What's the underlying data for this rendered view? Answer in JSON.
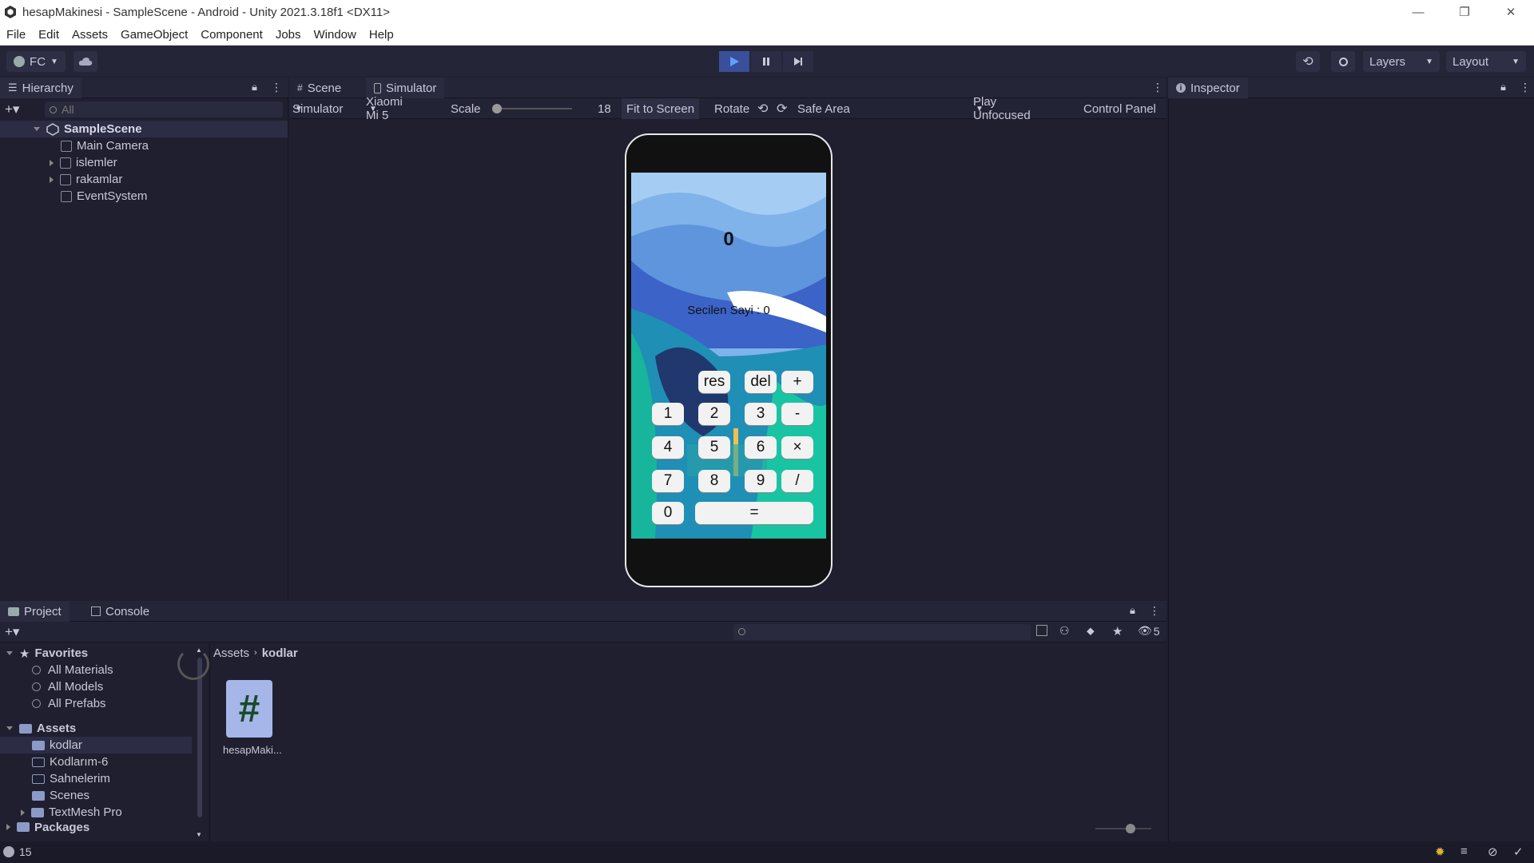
{
  "window": {
    "title": "hesapMakinesi - SampleScene - Android - Unity 2021.3.18f1 <DX11>",
    "controls": [
      "—",
      "❐",
      "✕"
    ]
  },
  "menu": [
    "File",
    "Edit",
    "Assets",
    "GameObject",
    "Component",
    "Jobs",
    "Window",
    "Help"
  ],
  "toolbar": {
    "account": "FC",
    "layers_label": "Layers",
    "layout_label": "Layout"
  },
  "hierarchy": {
    "tab_label": "Hierarchy",
    "search_placeholder": "All",
    "scene": "SampleScene",
    "objects": [
      "Main Camera",
      "islemler",
      "rakamlar",
      "EventSystem"
    ]
  },
  "center_tabs": {
    "scene": "Scene",
    "simulator": "Simulator"
  },
  "simulator_bar": {
    "mode": "Simulator",
    "device": "Xiaomi Mi 5",
    "scale_label": "Scale",
    "scale_value": "18",
    "fit": "Fit to Screen",
    "rotate": "Rotate",
    "safe_area": "Safe Area",
    "play_mode": "Play Unfocused",
    "control_panel": "Control Panel"
  },
  "calculator": {
    "display": "0",
    "selected_label": "Secilen Sayi : 0",
    "row1": [
      "res",
      "del",
      "+"
    ],
    "row2": [
      "1",
      "2",
      "3",
      "-"
    ],
    "row3": [
      "4",
      "5",
      "6",
      "×"
    ],
    "row4": [
      "7",
      "8",
      "9",
      "/"
    ],
    "zero": "0",
    "equals": "="
  },
  "inspector": {
    "tab_label": "Inspector"
  },
  "project": {
    "tab_project": "Project",
    "tab_console": "Console",
    "favorites_label": "Favorites",
    "favorites": [
      "All Materials",
      "All Models",
      "All Prefabs"
    ],
    "assets_label": "Assets",
    "asset_folders": [
      "kodlar",
      "Kodlarım-6",
      "Sahnelerim",
      "Scenes",
      "TextMesh Pro"
    ],
    "packages_label": "Packages",
    "breadcrumb": [
      "Assets",
      "kodlar"
    ],
    "file_name": "hesapMaki...",
    "hidden_count": "5"
  },
  "status": {
    "count": "15"
  },
  "colors": {
    "accent": "#3a6fd8",
    "panel_bg": "#1f1f30",
    "header_bg": "#252538"
  }
}
